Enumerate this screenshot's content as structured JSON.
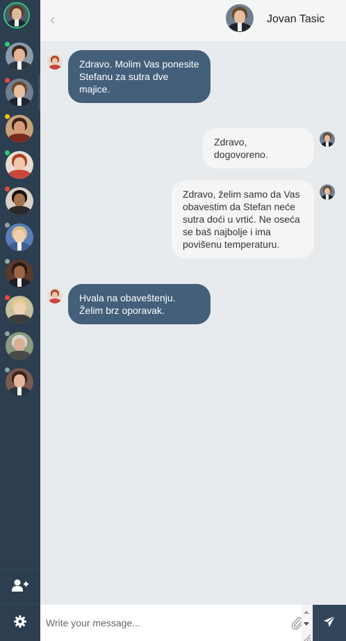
{
  "colors": {
    "sidebar_bg": "#2c3e50",
    "incoming_bubble": "#435f7a",
    "outgoing_bubble": "#f5f5f5",
    "online": "#2ecc71",
    "away": "#f1c40f",
    "busy": "#e74c3c",
    "offline": "#95a5a6"
  },
  "sidebar": {
    "me": {
      "avatar": "user-avatar",
      "status": "online"
    },
    "contacts": [
      {
        "avatar": "contact-avatar",
        "status": "online",
        "active": false
      },
      {
        "avatar": "contact-avatar",
        "status": "busy",
        "active": true
      },
      {
        "avatar": "contact-avatar",
        "status": "away",
        "active": false
      },
      {
        "avatar": "contact-avatar",
        "status": "online",
        "active": false
      },
      {
        "avatar": "contact-avatar",
        "status": "busy",
        "active": false
      },
      {
        "avatar": "contact-avatar",
        "status": "offline",
        "active": false
      },
      {
        "avatar": "contact-avatar",
        "status": "offline",
        "active": false
      },
      {
        "avatar": "contact-avatar",
        "status": "busy",
        "active": false
      },
      {
        "avatar": "contact-avatar",
        "status": "offline",
        "active": false
      },
      {
        "avatar": "contact-avatar",
        "status": "offline",
        "active": false
      }
    ],
    "add_contact_icon": "add-user-icon",
    "settings_icon": "gear-icon"
  },
  "header": {
    "back_icon": "chevron-left-icon",
    "back_glyph": "‹",
    "contact_name": "Jovan Tasic"
  },
  "messages": [
    {
      "direction": "in",
      "text": "Zdravo. Molim Vas ponesite Stefanu za sutra dve majice."
    },
    {
      "direction": "out",
      "text": "Zdravo, dogovoreno."
    },
    {
      "direction": "out",
      "text": "Zdravo, želim samo da Vas obavestim da Stefan neće sutra doći u vrtić. Ne oseća se baš najbolje i ima povišenu temperaturu."
    },
    {
      "direction": "in",
      "text": "Hvala na obaveštenju. Želim brz oporavak."
    }
  ],
  "composer": {
    "placeholder": "Write your message...",
    "value": "",
    "attach_icon": "paperclip-icon",
    "send_icon": "paper-plane-icon"
  }
}
